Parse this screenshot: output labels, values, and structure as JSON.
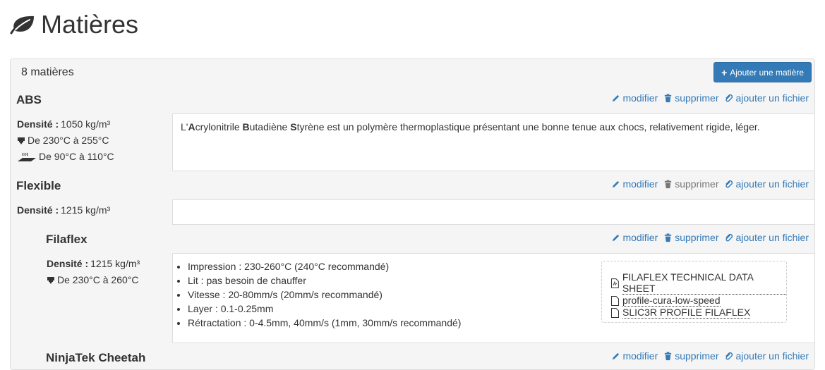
{
  "page": {
    "title": "Matières",
    "title_icon": "leaf-icon"
  },
  "panel": {
    "count_text": "8 matières",
    "add_button_label": "Ajouter une matière"
  },
  "actions": {
    "edit": "modifier",
    "delete": "supprimer",
    "add_file": "ajouter un fichier"
  },
  "materials": [
    {
      "name": "ABS",
      "density_label": "Densité :",
      "density_value": "1050 kg/m³",
      "print_temp": "De 230°C à 255°C",
      "bed_temp": "De 90°C à 110°C",
      "description_parts": [
        "L'",
        "A",
        "crylonitrile ",
        "B",
        "utadiène ",
        "S",
        "tyrène est un polymère thermoplastique présentant une bonne tenue aux chocs, relativement rigide, léger."
      ],
      "delete_enabled": true
    },
    {
      "name": "Flexible",
      "density_label": "Densité :",
      "density_value": "1215 kg/m³",
      "delete_enabled": false
    },
    {
      "name": "Filaflex",
      "density_label": "Densité :",
      "density_value": "1215 kg/m³",
      "print_temp": "De 230°C à 260°C",
      "specs": [
        "Impression : 230-260°C (240°C recommandé)",
        "Lit : pas besoin de chauffer",
        "Vitesse : 20-80mm/s (20mm/s recommandé)",
        "Layer : 0.1-0.25mm",
        "Rétractation : 0-4.5mm, 40mm/s (1mm, 30mm/s recommandé)"
      ],
      "files": [
        {
          "label": "FILAFLEX TECHNICAL DATA SHEET",
          "icon": "pdf-file-icon"
        },
        {
          "label": "profile-cura-low-speed",
          "icon": "file-icon"
        },
        {
          "label": "SLIC3R PROFILE FILAFLEX",
          "icon": "file-icon"
        }
      ],
      "delete_enabled": true
    },
    {
      "name": "NinjaTek Cheetah",
      "delete_enabled": true
    }
  ],
  "colors": {
    "link": "#337ab7",
    "primary_button": "#337ab7",
    "muted": "#777777",
    "row_bg": "#f5f5f5"
  }
}
